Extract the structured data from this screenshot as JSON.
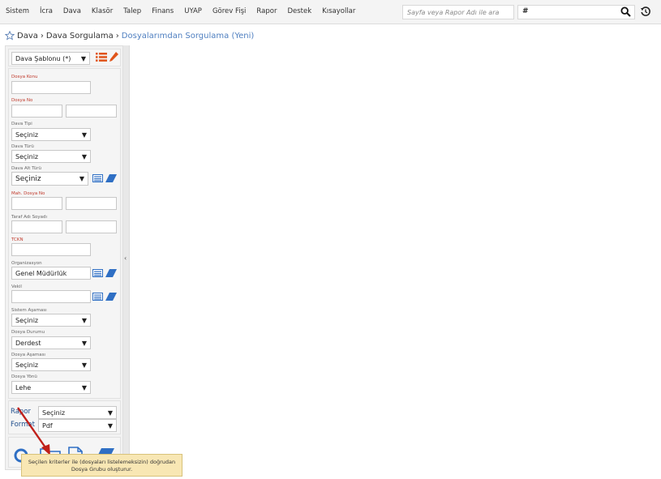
{
  "menu": {
    "items": [
      "Sistem",
      "İcra",
      "Dava",
      "Klasör",
      "Talep",
      "Finans",
      "UYAP",
      "Görev Fişi",
      "Rapor",
      "Destek",
      "Kısayollar"
    ]
  },
  "search": {
    "placeholder": "Sayfa veya Rapor Adı ile ara"
  },
  "hash_field": {
    "value": "#"
  },
  "breadcrumb": {
    "part1": "Dava",
    "sep": "›",
    "part2": "Dava Sorgulama",
    "part3": "Dosyalarımdan Sorgulama (Yeni)"
  },
  "template": {
    "value": "Dava Şablonu (*)"
  },
  "form": {
    "dosya_konu": "Dosya Konu",
    "dosya_no": "Dosya No",
    "dava_tipi": "Dava Tipi",
    "dava_tipi_value": "Seçiniz",
    "dava_turu": "Dava Türü",
    "dava_turu_value": "Seçiniz",
    "dava_alt_turu": "Dava Alt Türü",
    "dava_alt_turu_value": "Seçiniz",
    "mah_dosya_no": "Mah. Dosya No",
    "taraf_adi": "Taraf Adı Soyadı",
    "tckn": "TCKN",
    "organizasyon": "Organizasyon",
    "organizasyon_value": "Genel Müdürlük",
    "vekil": "Vekil",
    "sistem_asamasi": "Sistem Aşaması",
    "sistem_asamasi_value": "Seçiniz",
    "dosya_durumu": "Dosya Durumu",
    "dosya_durumu_value": "Derdest",
    "dosya_asamasi": "Dosya Aşaması",
    "dosya_asamasi_value": "Seçiniz",
    "dosya_yonu": "Dosya Yönü",
    "dosya_yonu_value": "Lehe"
  },
  "report": {
    "rapor_label": "Rapor",
    "rapor_value": "Seçiniz",
    "format_label": "Format",
    "format_value": "Pdf"
  },
  "tooltip": {
    "line1": "Seçilen kriterler ile (dosyaları listelemeksizin) doğrudan",
    "line2": "Dosya Grubu oluşturur."
  },
  "colors": {
    "accent": "#3a6fb0",
    "required": "#c0392b",
    "tooltip_bg": "#f8e7b4",
    "arrow": "#c0201a"
  }
}
